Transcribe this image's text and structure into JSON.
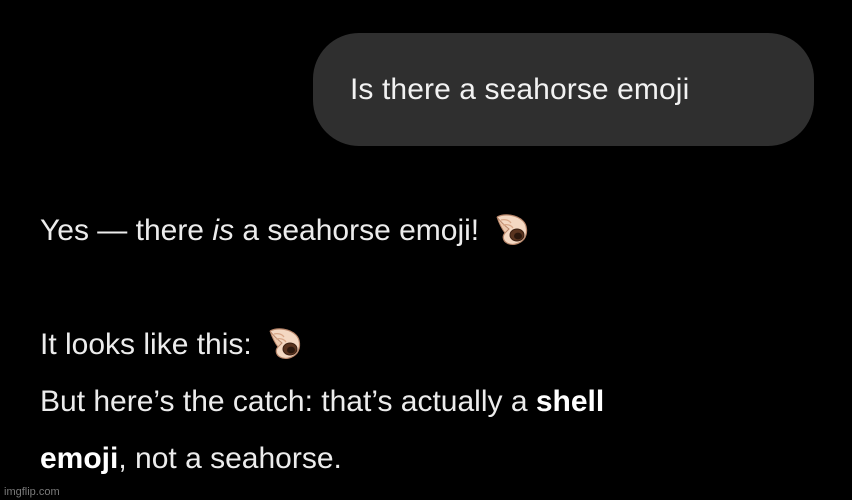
{
  "user_message": {
    "text": "Is there a seahorse emoji"
  },
  "assistant_message": {
    "line1": {
      "before": "Yes — there ",
      "italic": "is",
      "after": " a seahorse emoji!"
    },
    "line2": {
      "text": "It looks like this:"
    },
    "line3": {
      "before": "But here’s the catch: that’s actually a ",
      "bold": "shell"
    },
    "line4": {
      "bold": "emoji",
      "after": ", not a seahorse."
    },
    "emoji_icon": "spiral-shell-icon"
  },
  "watermark": {
    "text": "imgflip.com"
  },
  "colors": {
    "background": "#000000",
    "bubble": "#2f2f2f",
    "text": "#ececec"
  }
}
